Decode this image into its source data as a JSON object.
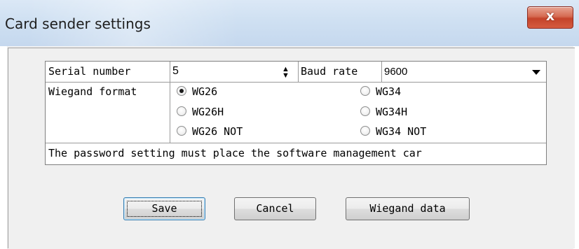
{
  "window": {
    "title": "Card sender settings",
    "close_glyph": "x"
  },
  "settings": {
    "serial_label": "Serial number",
    "serial_value": "5",
    "baud_label": "Baud rate",
    "baud_value": "9600",
    "wiegand_label": "Wiegand format",
    "wiegand_options": [
      {
        "label": "WG26",
        "checked": true
      },
      {
        "label": "WG34",
        "checked": false
      },
      {
        "label": "WG26H",
        "checked": false
      },
      {
        "label": "WG34H",
        "checked": false
      },
      {
        "label": "WG26 NOT",
        "checked": false
      },
      {
        "label": "WG34 NOT",
        "checked": false
      }
    ],
    "password_note": "The password setting must place the software management car"
  },
  "buttons": {
    "save": "Save",
    "cancel": "Cancel",
    "wiegand_data": "Wiegand data"
  },
  "icons": {
    "spinner": "spin-up-down-icon",
    "dropdown": "chevron-down-icon",
    "close": "close-icon"
  }
}
